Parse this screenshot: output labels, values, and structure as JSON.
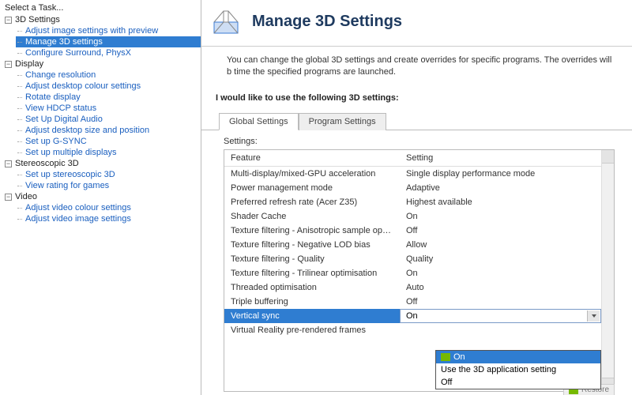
{
  "sidebar": {
    "title": "Select a Task...",
    "groups": [
      {
        "label": "3D Settings",
        "items": [
          {
            "label": "Adjust image settings with preview",
            "selected": false
          },
          {
            "label": "Manage 3D settings",
            "selected": true
          },
          {
            "label": "Configure Surround, PhysX",
            "selected": false
          }
        ]
      },
      {
        "label": "Display",
        "items": [
          {
            "label": "Change resolution"
          },
          {
            "label": "Adjust desktop colour settings"
          },
          {
            "label": "Rotate display"
          },
          {
            "label": "View HDCP status"
          },
          {
            "label": "Set Up Digital Audio"
          },
          {
            "label": "Adjust desktop size and position"
          },
          {
            "label": "Set up G-SYNC"
          },
          {
            "label": "Set up multiple displays"
          }
        ]
      },
      {
        "label": "Stereoscopic 3D",
        "items": [
          {
            "label": "Set up stereoscopic 3D"
          },
          {
            "label": "View rating for games"
          }
        ]
      },
      {
        "label": "Video",
        "items": [
          {
            "label": "Adjust video colour settings"
          },
          {
            "label": "Adjust video image settings"
          }
        ]
      }
    ]
  },
  "header": {
    "title": "Manage 3D Settings"
  },
  "description": "You can change the global 3D settings and create overrides for specific programs. The overrides will b time the specified programs are launched.",
  "subhead": "I would like to use the following 3D settings:",
  "tabs": [
    {
      "label": "Global Settings",
      "active": true
    },
    {
      "label": "Program Settings",
      "active": false
    }
  ],
  "settings_label": "Settings:",
  "columns": {
    "feature": "Feature",
    "setting": "Setting"
  },
  "rows": [
    {
      "feature": "Multi-display/mixed-GPU acceleration",
      "setting": "Single display performance mode"
    },
    {
      "feature": "Power management mode",
      "setting": "Adaptive"
    },
    {
      "feature": "Preferred refresh rate (Acer Z35)",
      "setting": "Highest available"
    },
    {
      "feature": "Shader Cache",
      "setting": "On"
    },
    {
      "feature": "Texture filtering - Anisotropic sample opti...",
      "setting": "Off"
    },
    {
      "feature": "Texture filtering - Negative LOD bias",
      "setting": "Allow"
    },
    {
      "feature": "Texture filtering - Quality",
      "setting": "Quality"
    },
    {
      "feature": "Texture filtering - Trilinear optimisation",
      "setting": "On"
    },
    {
      "feature": "Threaded optimisation",
      "setting": "Auto"
    },
    {
      "feature": "Triple buffering",
      "setting": "Off"
    },
    {
      "feature": "Vertical sync",
      "setting": "On",
      "selected": true
    },
    {
      "feature": "Virtual Reality pre-rendered frames",
      "setting": ""
    }
  ],
  "dropdown": {
    "options": [
      {
        "label": "On",
        "highlighted": true
      },
      {
        "label": "Use the 3D application setting"
      },
      {
        "label": "Off"
      }
    ]
  },
  "restore": "Restore"
}
